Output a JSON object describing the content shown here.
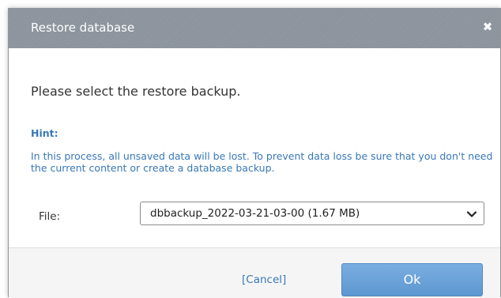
{
  "dialog": {
    "title": "Restore database",
    "close_icon": "close-icon",
    "prompt": "Please select the restore backup.",
    "hint": {
      "title": "Hint:",
      "text": "In this process, all unsaved data will be lost. To prevent data loss be sure that you don't need the current content or create a database backup."
    },
    "file": {
      "label": "File:",
      "selected": "dbbackup_2022-03-21-03-00 (1.67 MB)",
      "dropdown_icon": "chevron-down-icon"
    },
    "footer": {
      "cancel_label": "[Cancel]",
      "ok_label": "Ok"
    }
  },
  "colors": {
    "titlebar": "#8b939c",
    "hint": "#3878b8",
    "ok_button": "#6aa3d9",
    "footer": "#f5f5f5"
  }
}
